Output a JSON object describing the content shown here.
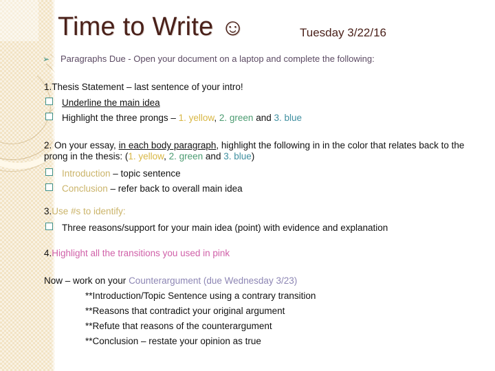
{
  "slide": {
    "title": "Time to Write",
    "title_smiley": "☺",
    "date": "Tuesday 3/22/16",
    "lead": {
      "bullet": "➢",
      "text": "Paragraphs Due  - Open your document on a laptop and complete the following:"
    },
    "section1": {
      "heading": "1.Thesis Statement – last sentence of your intro!",
      "item1": "Underline the main idea",
      "item2_prefix": "Highlight the three prongs – ",
      "item2_yellow": "1. yellow",
      "item2_comma": ", ",
      "item2_green": "2. green",
      "item2_and": " and ",
      "item2_blue": "3. blue"
    },
    "section2": {
      "para_a": "2. On your essay, ",
      "para_underline": "in each body paragraph",
      "para_b": ", highlight the following in in the color that relates back to the prong in the thesis: (",
      "para_yellow": "1. yellow",
      "para_comma": ", ",
      "para_green": "2. green",
      "para_and": " and ",
      "para_blue": "3. blue",
      "para_close": ")",
      "item1_colored": "Introduction",
      "item1_rest": " – topic sentence",
      "item2_colored": "Conclusion",
      "item2_rest": " – refer back to overall main idea"
    },
    "section3": {
      "heading_num": "3.",
      "heading_colored": "Use #s to identify:",
      "item1": "Three reasons/support for your main idea (point) with evidence and explanation"
    },
    "section4": {
      "heading_num": "4.",
      "heading_colored": "Highlight all the transitions you used in pink"
    },
    "closing": {
      "lead_a": "Now – work on your ",
      "lead_colored": "Counterargument (due Wednesday 3/23)",
      "item1": "**Introduction/Topic Sentence using a contrary transition",
      "item2": "**Reasons that contradict your original argument",
      "item3": "**Refute that reasons of the counterargument",
      "item4": "**Conclusion – restate your opinion as true"
    }
  },
  "colors": {
    "title": "#4a211a",
    "band": "#f2e3c4",
    "yellow": "#d8b744",
    "green": "#4a9b70",
    "blue": "#3f8fa0",
    "gold": "#cbb46a",
    "pink": "#d060a8",
    "purple": "#8d86b4",
    "checkbox": "#3d8f88",
    "arrow": "#2f8a7e"
  }
}
